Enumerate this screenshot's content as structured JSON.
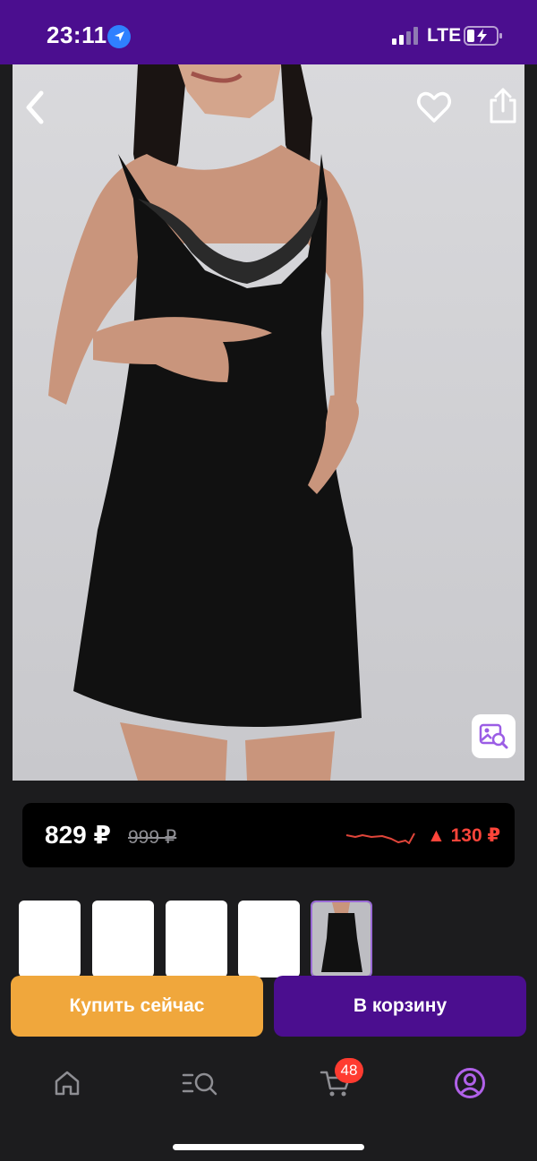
{
  "status_bar": {
    "time": "23:11",
    "network": "LTE",
    "icons": [
      "location-arrow-icon",
      "signal-icon",
      "battery-charging-icon"
    ]
  },
  "product": {
    "image_alt": "",
    "icons": [
      "back-icon",
      "heart-icon",
      "share-icon",
      "image-search-icon"
    ]
  },
  "price": {
    "current": "829 ₽",
    "old": "999 ₽",
    "change": "▲ 130 ₽",
    "change_color": "#ff453a"
  },
  "thumbnails": {
    "count": 5,
    "selected_index": 4
  },
  "actions": {
    "buy_now": "Купить сейчас",
    "add_to_cart": "В корзину"
  },
  "tabbar": {
    "items": [
      {
        "icon": "home-icon"
      },
      {
        "icon": "catalog-search-icon"
      },
      {
        "icon": "cart-icon",
        "badge": "48"
      },
      {
        "icon": "profile-icon",
        "active": true
      }
    ]
  },
  "colors": {
    "brand": "#4b0e8f",
    "buy_now": "#f0a73c",
    "active_tab": "#b061e8"
  }
}
